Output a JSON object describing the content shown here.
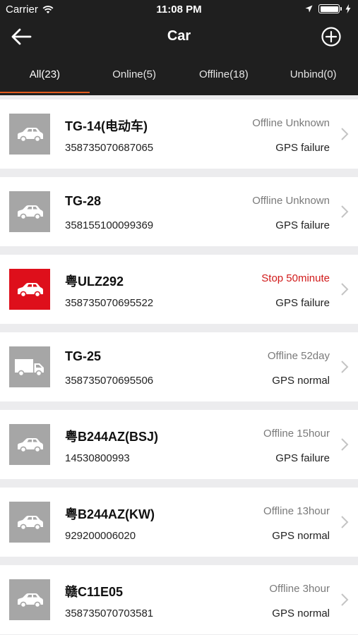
{
  "status_bar": {
    "carrier": "Carrier",
    "time": "11:08 PM"
  },
  "header": {
    "title": "Car"
  },
  "tabs": [
    {
      "label": "All(23)",
      "active": true
    },
    {
      "label": "Online(5)",
      "active": false
    },
    {
      "label": "Offline(18)",
      "active": false
    },
    {
      "label": "Unbind(0)",
      "active": false
    }
  ],
  "colors": {
    "accent": "#e05a1d",
    "alert": "#d11a1a",
    "header_bg": "#1f1f1f"
  },
  "vehicles": [
    {
      "name": "TG-14(电动车)",
      "imei": "358735070687065",
      "state": "Offline Unknown",
      "gps": "GPS failure",
      "icon": "car-icon",
      "alert": false
    },
    {
      "name": "TG-28",
      "imei": "358155100099369",
      "state": "Offline Unknown",
      "gps": "GPS failure",
      "icon": "car-icon",
      "alert": false
    },
    {
      "name": "粤ULZ292",
      "imei": "358735070695522",
      "state": "Stop 50minute",
      "gps": "GPS failure",
      "icon": "car-icon",
      "alert": true
    },
    {
      "name": "TG-25",
      "imei": "358735070695506",
      "state": "Offline 52day",
      "gps": "GPS normal",
      "icon": "truck-icon",
      "alert": false
    },
    {
      "name": "粤B244AZ(BSJ)",
      "imei": "14530800993",
      "state": "Offline 15hour",
      "gps": "GPS failure",
      "icon": "car-icon",
      "alert": false
    },
    {
      "name": "粤B244AZ(KW)",
      "imei": "929200006020",
      "state": "Offline 13hour",
      "gps": "GPS normal",
      "icon": "car-icon",
      "alert": false
    },
    {
      "name": "赣C11E05",
      "imei": "358735070703581",
      "state": "Offline 3hour",
      "gps": "GPS normal",
      "icon": "car-icon",
      "alert": false
    }
  ]
}
